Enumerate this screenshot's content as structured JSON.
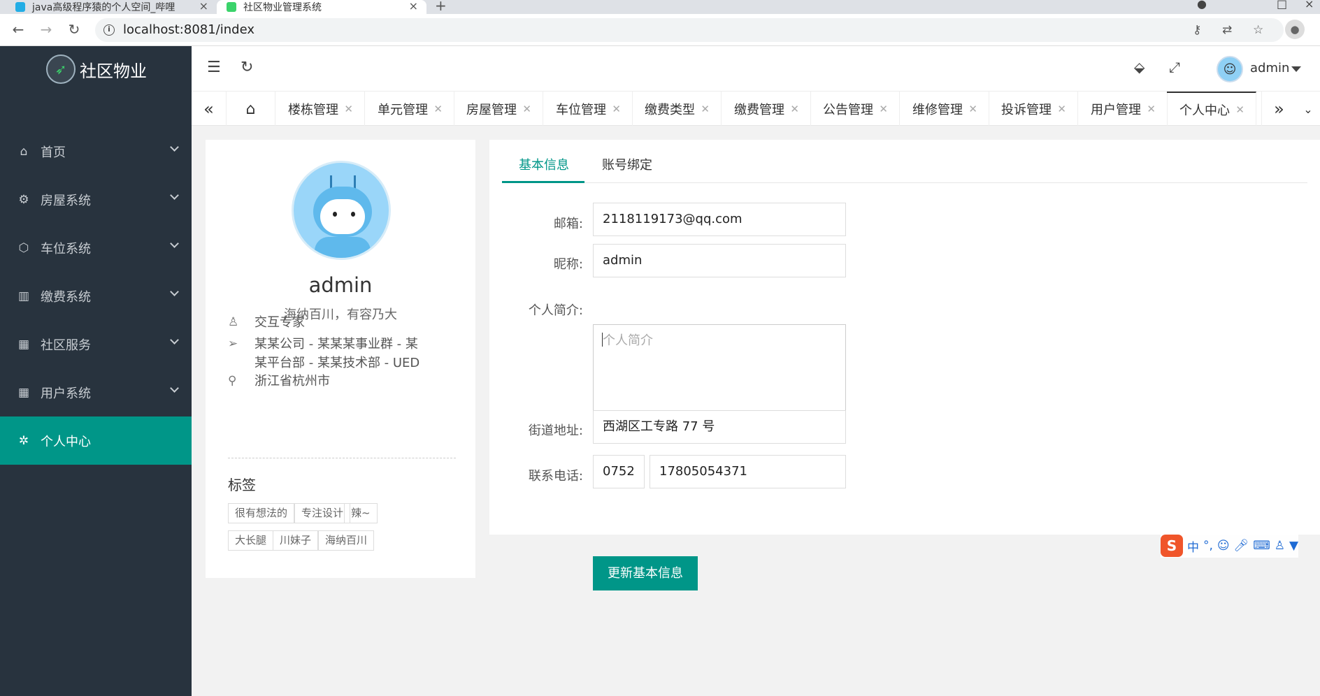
{
  "browser": {
    "tab1_title": "java高级程序猿的个人空间_哔哩",
    "tab2_title": "社区物业管理系统",
    "url": "localhost:8081/index"
  },
  "app": {
    "logo_text": "社区物业"
  },
  "sidebar": {
    "items": [
      {
        "label": "首页",
        "icon": "home-icon"
      },
      {
        "label": "房屋系统",
        "icon": "gear-icon"
      },
      {
        "label": "车位系统",
        "icon": "cube-icon"
      },
      {
        "label": "缴费系统",
        "icon": "book-icon"
      },
      {
        "label": "社区服务",
        "icon": "app-grid-icon"
      },
      {
        "label": "用户系统",
        "icon": "app-grid-icon"
      },
      {
        "label": "个人中心",
        "icon": "settings-icon"
      }
    ]
  },
  "header": {
    "username": "admin"
  },
  "page_tabs": [
    "楼栋管理",
    "单元管理",
    "房屋管理",
    "车位管理",
    "缴费类型",
    "缴费管理",
    "公告管理",
    "维修管理",
    "投诉管理",
    "用户管理",
    "个人中心"
  ],
  "profile": {
    "name": "admin",
    "motto": "海纳百川，有容乃大",
    "role": "交互专家",
    "org": "某某公司 - 某某某事业群 - 某某平台部 - 某某技术部 - UED",
    "location": "浙江省杭州市",
    "tags_title": "标签",
    "tags": [
      "很有想法的",
      "专注设计",
      "辣~",
      "大长腿",
      "川妹子",
      "海纳百川"
    ]
  },
  "form": {
    "tab_basic": "基本信息",
    "tab_bind": "账号绑定",
    "email_label": "邮箱:",
    "email_value": "2118119173@qq.com",
    "nick_label": "昵称:",
    "nick_value": "admin",
    "bio_label": "个人简介:",
    "bio_placeholder": "个人简介",
    "addr_label": "街道地址:",
    "addr_value": "西湖区工专路 77 号",
    "phone_label": "联系电话:",
    "phone_area": "0752",
    "phone_number": "17805054371",
    "submit": "更新基本信息"
  },
  "colors": {
    "accent": "#009688",
    "sidebar_bg": "#28333e"
  }
}
